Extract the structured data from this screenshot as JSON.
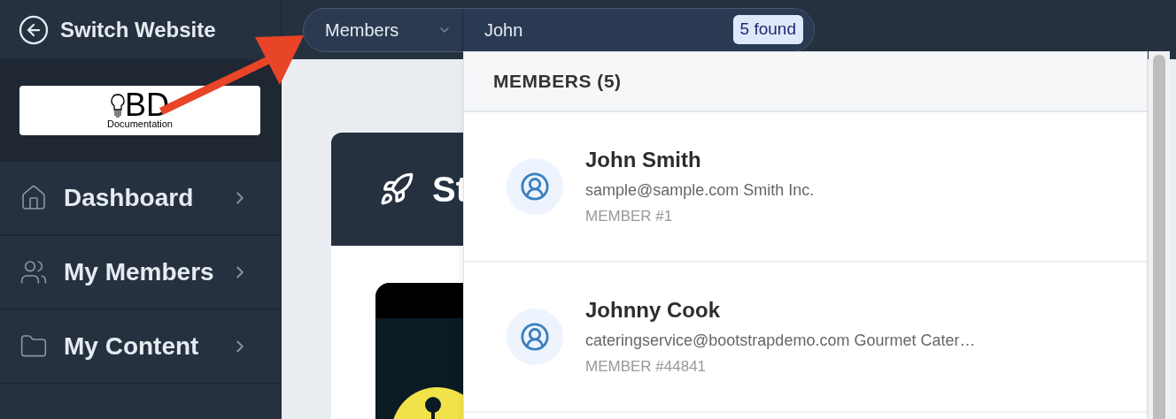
{
  "header": {
    "back_label": "Switch Website"
  },
  "search": {
    "scope": "Members",
    "value": "John",
    "found_badge": "5 found"
  },
  "logo": {
    "letters": "BD",
    "caption": "Documentation"
  },
  "sidebar": {
    "items": [
      {
        "label": "Dashboard",
        "kind": "home"
      },
      {
        "label": "My Members",
        "kind": "members"
      },
      {
        "label": "My Content",
        "kind": "content"
      }
    ]
  },
  "card": {
    "title": "St"
  },
  "results": {
    "heading": "MEMBERS (5)",
    "items": [
      {
        "name": "John Smith",
        "details": "sample@sample.com Smith Inc.",
        "member_number": "MEMBER #1"
      },
      {
        "name": "Johnny Cook",
        "details": "cateringservice@bootstrapdemo.com Gourmet Cater…",
        "member_number": "MEMBER #44841"
      }
    ]
  }
}
